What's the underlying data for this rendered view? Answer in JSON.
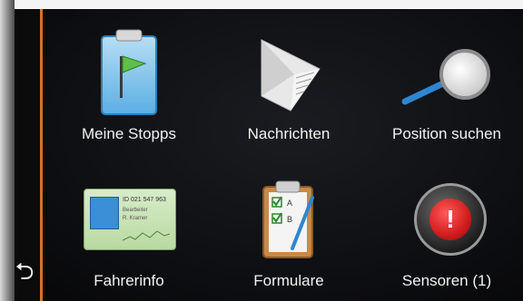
{
  "menu": {
    "items": [
      {
        "label": "Meine Stopps",
        "icon": "clipboard-flag-icon"
      },
      {
        "label": "Nachrichten",
        "icon": "message-envelope-icon"
      },
      {
        "label": "Position suchen",
        "icon": "magnifier-icon"
      },
      {
        "label": "Fahrerinfo",
        "icon": "driver-card-icon"
      },
      {
        "label": "Formulare",
        "icon": "form-clipboard-icon"
      },
      {
        "label": "Sensoren (1)",
        "icon": "alert-sensor-icon"
      }
    ]
  },
  "driver_card": {
    "id_text": "ID 021 547 963",
    "line1": "Bearbeiter",
    "line2": "R. Kramer"
  },
  "form_icon": {
    "letter_a": "A",
    "letter_b": "B"
  },
  "alert_symbol": "!",
  "nav": {
    "back_symbol": "⮌"
  },
  "colors": {
    "accent": "#d9702b",
    "alert_red": "#d21c1c",
    "flag_green": "#5fbf4a"
  }
}
